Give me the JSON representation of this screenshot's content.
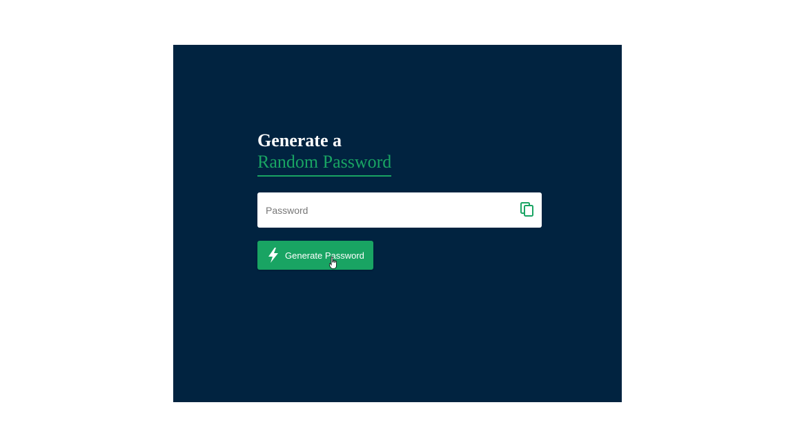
{
  "heading": {
    "line1": "Generate a",
    "line2": "Random Password"
  },
  "password_field": {
    "value": "",
    "placeholder": "Password",
    "copy_icon": "copy-icon"
  },
  "generate_button": {
    "label": "Generate Password",
    "icon": "lightning-bolt-icon"
  },
  "colors": {
    "background": "#012340",
    "accent": "#19a463",
    "page": "#ffffff"
  }
}
